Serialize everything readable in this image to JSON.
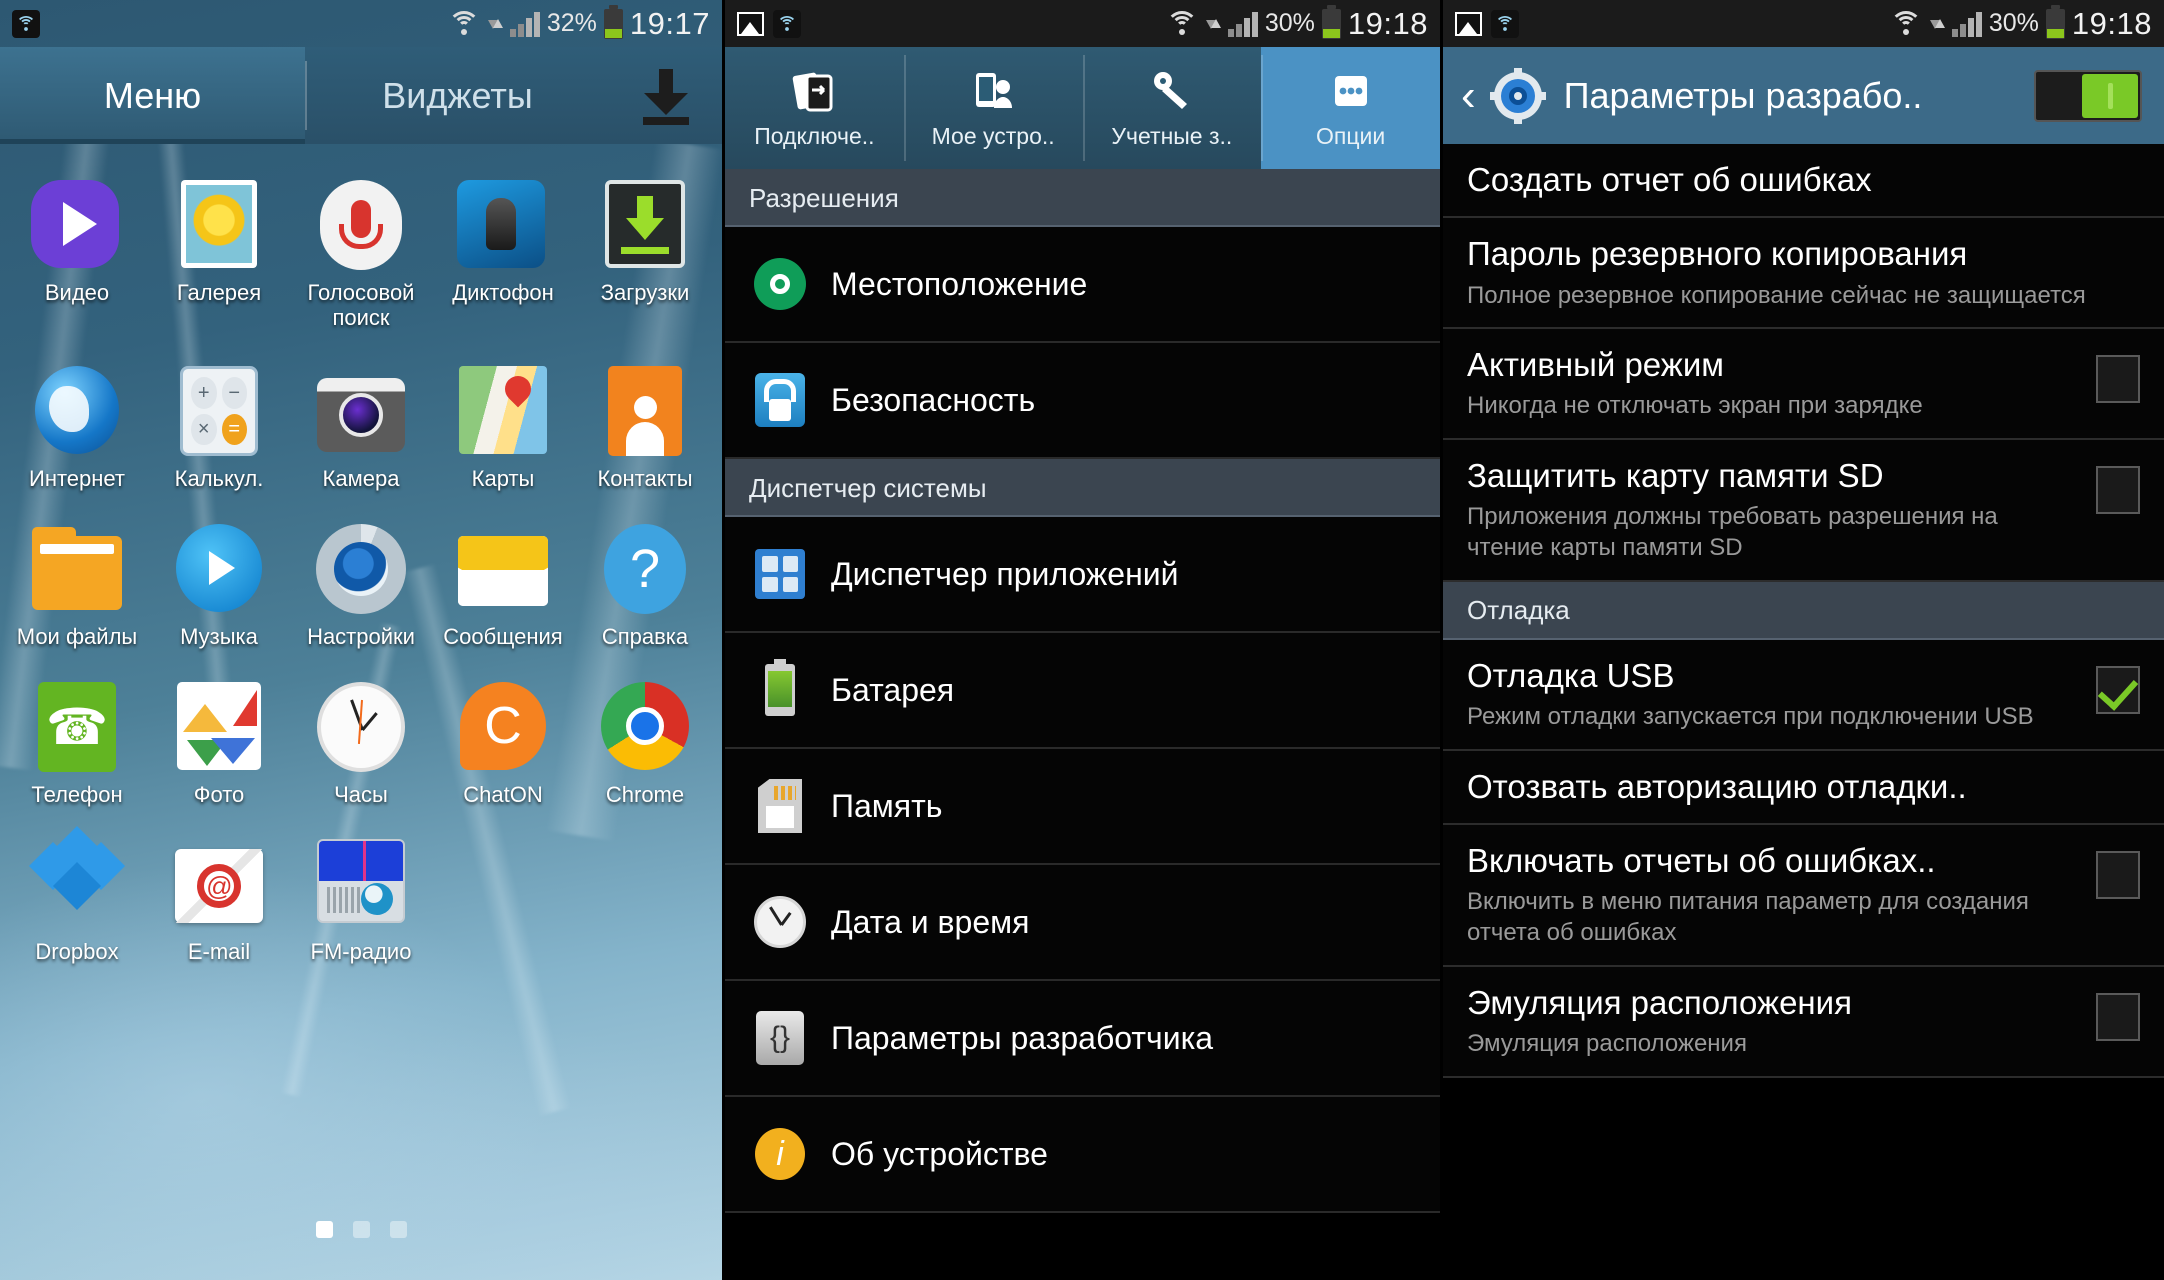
{
  "panel_home": {
    "statusbar": {
      "battery_percent": "32%",
      "time": "19:17",
      "icons": [
        "wifi-icon",
        "data-arrows-icon",
        "signal-icon",
        "battery-icon"
      ]
    },
    "tabs": [
      {
        "label": "Меню",
        "active": true
      },
      {
        "label": "Виджеты",
        "active": false
      }
    ],
    "download_icon": "download-icon",
    "app_rows": [
      [
        {
          "label": "Видео",
          "icon": "video-icon"
        },
        {
          "label": "Галерея",
          "icon": "gallery-icon"
        },
        {
          "label": "Голосовой поиск",
          "icon": "microphone-icon"
        },
        {
          "label": "Диктофон",
          "icon": "voice-recorder-icon"
        },
        {
          "label": "Загрузки",
          "icon": "downloads-icon"
        }
      ],
      [
        {
          "label": "Интернет",
          "icon": "globe-icon"
        },
        {
          "label": "Калькул.",
          "icon": "calculator-icon"
        },
        {
          "label": "Камера",
          "icon": "camera-icon"
        },
        {
          "label": "Карты",
          "icon": "maps-icon"
        },
        {
          "label": "Контакты",
          "icon": "contacts-icon"
        }
      ],
      [
        {
          "label": "Мои файлы",
          "icon": "folder-icon"
        },
        {
          "label": "Музыка",
          "icon": "music-icon"
        },
        {
          "label": "Настройки",
          "icon": "settings-gear-icon"
        },
        {
          "label": "Сообщения",
          "icon": "envelope-icon"
        },
        {
          "label": "Справка",
          "icon": "question-mark-icon"
        }
      ],
      [
        {
          "label": "Телефон",
          "icon": "phone-icon"
        },
        {
          "label": "Фото",
          "icon": "google-photos-icon"
        },
        {
          "label": "Часы",
          "icon": "clock-icon"
        },
        {
          "label": "ChatON",
          "icon": "chaton-icon"
        },
        {
          "label": "Chrome",
          "icon": "chrome-icon"
        }
      ],
      [
        {
          "label": "Dropbox",
          "icon": "dropbox-icon"
        },
        {
          "label": "E-mail",
          "icon": "email-icon"
        },
        {
          "label": "FM-радио",
          "icon": "fm-radio-icon"
        }
      ]
    ],
    "page_dots": {
      "count": 3,
      "active_index": 0
    }
  },
  "panel_settings": {
    "statusbar": {
      "battery_percent": "30%",
      "time": "19:18",
      "icons": [
        "screenshot-icon",
        "wifi-icon",
        "wifi-icon",
        "data-arrows-icon",
        "signal-icon",
        "battery-icon"
      ]
    },
    "tabs": [
      {
        "label": "Подключе..",
        "icon": "connections-icon",
        "active": false
      },
      {
        "label": "Мое устро..",
        "icon": "my-device-icon",
        "active": false
      },
      {
        "label": "Учетные з..",
        "icon": "accounts-icon",
        "active": false
      },
      {
        "label": "Опции",
        "icon": "more-options-icon",
        "active": true
      }
    ],
    "sections": [
      {
        "title": "Разрешения",
        "items": [
          {
            "label": "Местоположение",
            "icon": "location-icon"
          },
          {
            "label": "Безопасность",
            "icon": "lock-icon"
          }
        ]
      },
      {
        "title": "Диспетчер системы",
        "items": [
          {
            "label": "Диспетчер приложений",
            "icon": "application-manager-icon"
          },
          {
            "label": "Батарея",
            "icon": "battery-icon"
          },
          {
            "label": "Память",
            "icon": "sd-card-icon"
          },
          {
            "label": "Дата и время",
            "icon": "clock-icon"
          },
          {
            "label": "Параметры разработчика",
            "icon": "braces-icon"
          },
          {
            "label": "Об устройстве",
            "icon": "info-icon"
          }
        ]
      }
    ]
  },
  "panel_developer": {
    "statusbar": {
      "battery_percent": "30%",
      "time": "19:18",
      "icons": [
        "screenshot-icon",
        "wifi-icon",
        "wifi-icon",
        "data-arrows-icon",
        "signal-icon",
        "battery-icon"
      ]
    },
    "header": {
      "back_icon": "back-chevron-icon",
      "gear_icon": "settings-gear-icon",
      "title": "Параметры разрабо..",
      "master_toggle": {
        "state": "on",
        "color": "#7ac927"
      }
    },
    "rows": [
      {
        "type": "item",
        "title": "Создать отчет об ошибках",
        "sub": "",
        "checkbox": null
      },
      {
        "type": "item",
        "title": "Пароль резервного копирования",
        "sub": "Полное резервное копирование сейчас не защищается",
        "checkbox": null
      },
      {
        "type": "item",
        "title": "Активный режим",
        "sub": "Никогда не отключать экран при зарядке",
        "checkbox": "off"
      },
      {
        "type": "item",
        "title": "Защитить карту памяти SD",
        "sub": "Приложения должны требовать разрешения на чтение карты памяти SD",
        "checkbox": "off"
      },
      {
        "type": "section",
        "title": "Отладка"
      },
      {
        "type": "item",
        "title": "Отладка USB",
        "sub": "Режим отладки запускается при подключении USB",
        "checkbox": "on"
      },
      {
        "type": "item",
        "title": "Отозвать авторизацию отладки..",
        "sub": "",
        "checkbox": null
      },
      {
        "type": "item",
        "title": "Включать отчеты об ошибках..",
        "sub": "Включить в меню питания параметр для создания отчета об ошибках",
        "checkbox": "off"
      },
      {
        "type": "item",
        "title": "Эмуляция расположения",
        "sub": "Эмуляция расположения",
        "checkbox": "off"
      }
    ]
  }
}
